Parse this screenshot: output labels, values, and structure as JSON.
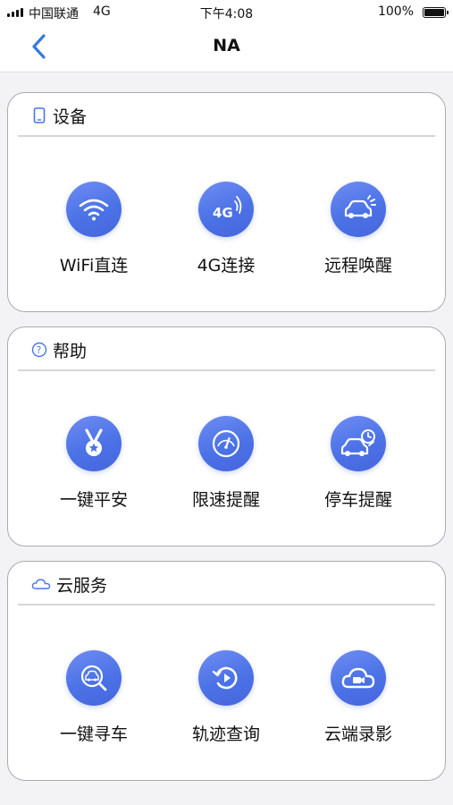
{
  "status_bar": {
    "carrier": "中国联通",
    "network": "4G",
    "time": "下午4:08",
    "battery": "100%"
  },
  "nav": {
    "title": "NA"
  },
  "sections": [
    {
      "title": "设备",
      "icon": "phone-icon",
      "items": [
        {
          "label": "WiFi直连",
          "icon": "wifi-icon"
        },
        {
          "label": "4G连接",
          "icon": "4g-signal-icon",
          "icon_text": "4G"
        },
        {
          "label": "远程唤醒",
          "icon": "car-wake-icon"
        }
      ]
    },
    {
      "title": "帮助",
      "icon": "help-icon",
      "icon_text": "?",
      "items": [
        {
          "label": "一键平安",
          "icon": "medal-icon"
        },
        {
          "label": "限速提醒",
          "icon": "speedometer-icon"
        },
        {
          "label": "停车提醒",
          "icon": "car-clock-icon"
        }
      ]
    },
    {
      "title": "云服务",
      "icon": "cloud-icon",
      "items": [
        {
          "label": "一键寻车",
          "icon": "car-search-icon"
        },
        {
          "label": "轨迹查询",
          "icon": "replay-icon"
        },
        {
          "label": "云端录影",
          "icon": "cloud-video-icon"
        }
      ]
    }
  ],
  "colors": {
    "accent": "#4a74e8",
    "back_arrow": "#3a78e0",
    "card_border": "#a9aab2",
    "background": "#f3f3f5"
  }
}
